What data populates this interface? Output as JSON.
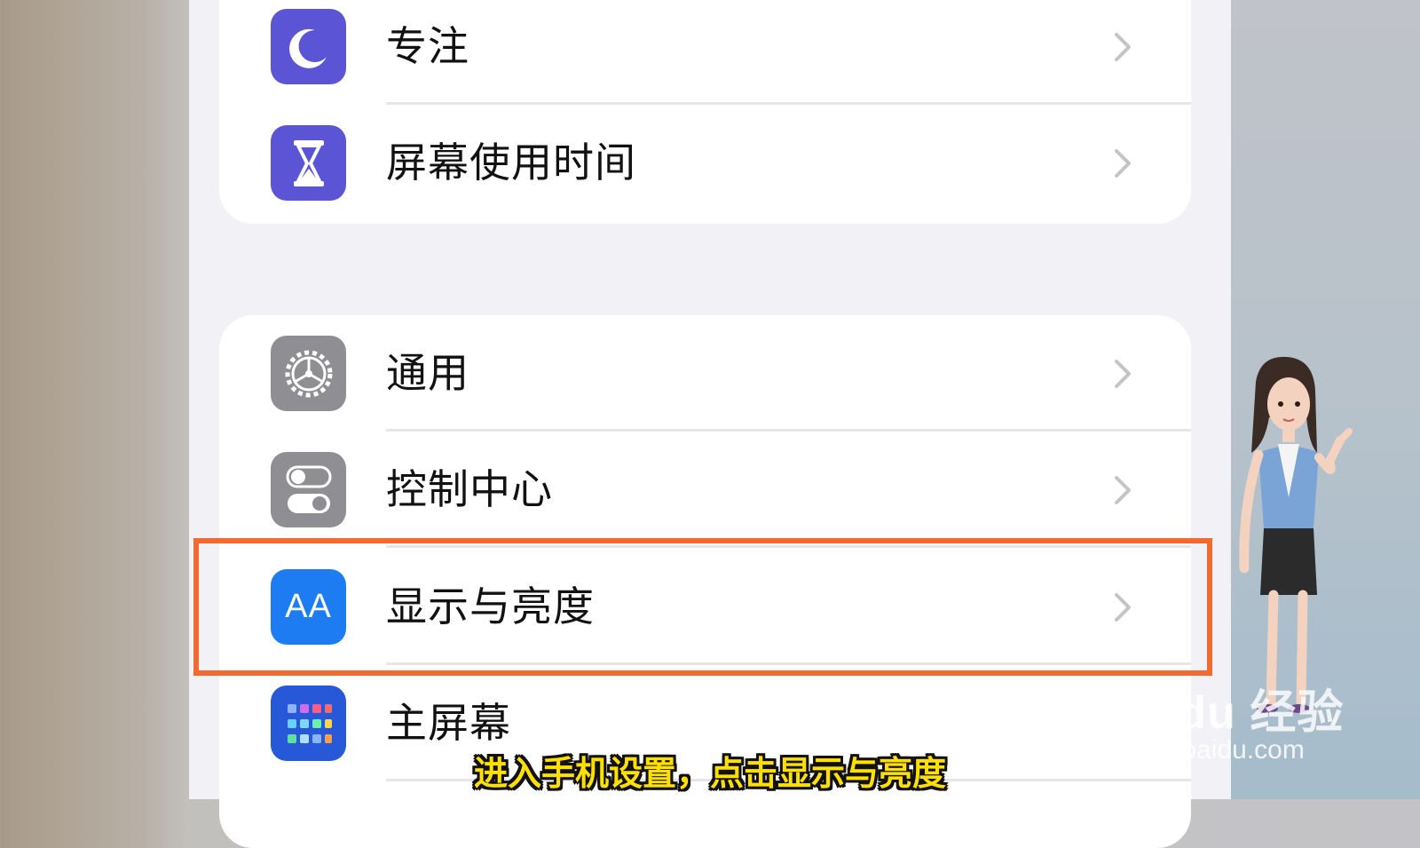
{
  "settings": {
    "rows": [
      {
        "label": "专注",
        "icon": "moon-icon",
        "color": "#5b55d6"
      },
      {
        "label": "屏幕使用时间",
        "icon": "hourglass-icon",
        "color": "#5b55d6"
      },
      {
        "label": "通用",
        "icon": "gear-icon",
        "color": "#8e8e93"
      },
      {
        "label": "控制中心",
        "icon": "toggles-icon",
        "color": "#8e8e93"
      },
      {
        "label": "显示与亮度",
        "icon": "text-size-icon",
        "icon_text": "AA",
        "color": "#1e7cf2"
      },
      {
        "label": "主屏幕",
        "icon": "home-grid-icon",
        "color": "#2758d8"
      }
    ]
  },
  "highlight": {
    "color": "#f26a2f",
    "target": "显示与亮度"
  },
  "subtitle": "进入手机设置，点击显示与亮度",
  "watermark": {
    "logo": "Bai du 经验",
    "url": "jingyan.baidu.com"
  }
}
